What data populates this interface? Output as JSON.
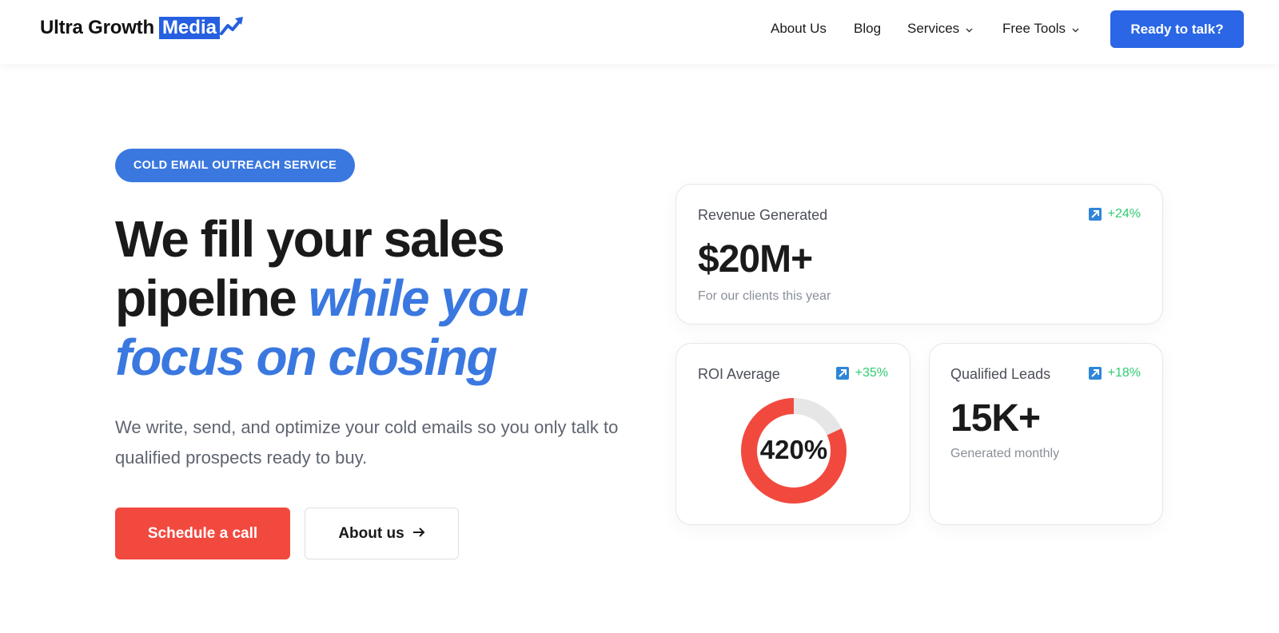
{
  "header": {
    "logo_primary": "Ultra Growth",
    "logo_accent": "Media",
    "nav": [
      {
        "label": "About Us"
      },
      {
        "label": "Blog"
      },
      {
        "label": "Services"
      },
      {
        "label": "Free Tools"
      }
    ],
    "cta": "Ready to talk?"
  },
  "hero": {
    "badge": "COLD EMAIL OUTREACH SERVICE",
    "headline_part1": "We fill your sales pipeline ",
    "headline_highlight": "while you focus on closing",
    "subtext": "We write, send, and optimize your cold emails so you only talk to qualified prospects ready to buy.",
    "primary_button": "Schedule a call",
    "secondary_button": "About us"
  },
  "cards": {
    "revenue": {
      "title": "Revenue Generated",
      "trend": "+24%",
      "value": "$20M+",
      "note": "For our clients this year"
    },
    "roi": {
      "title": "ROI Average",
      "trend": "+35%",
      "value": "420%",
      "progress_fraction": 0.82
    },
    "leads": {
      "title": "Qualified Leads",
      "trend": "+18%",
      "value": "15K+",
      "note": "Generated monthly"
    }
  },
  "colors": {
    "brand_blue": "#2a66e5",
    "accent_blue": "#3a78e0",
    "cta_red": "#f2493f",
    "trend_green": "#2ecc71",
    "donut_track": "#e6e6e6"
  },
  "icons": {
    "trend": "trend-up-icon",
    "logo_arrow": "growth-arrow-icon",
    "chevron": "chevron-down-icon",
    "arrow": "arrow-right-icon"
  }
}
